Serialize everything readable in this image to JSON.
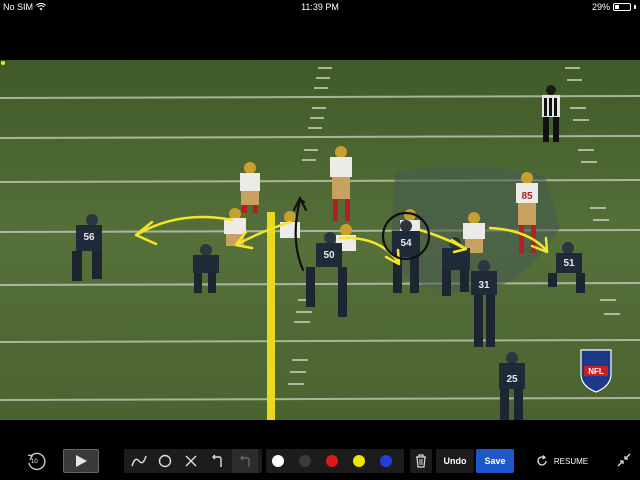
{
  "status_bar": {
    "carrier": "No SIM",
    "time": "11:39 PM",
    "battery": "29%",
    "battery_level": 0.29
  },
  "video": {
    "field_logo": "NFL",
    "jerseys": {
      "player_1": "56",
      "player_2": "50",
      "player_3": "54",
      "player_4": "31",
      "player_5": "51",
      "player_6": "25",
      "player_7": "85"
    }
  },
  "toolbar": {
    "rewind_label": "10",
    "play_icon": "play-icon",
    "drawing_tools": [
      "curve-tool-icon",
      "circle-tool-icon",
      "x-tool-icon",
      "arrow-tool-icon",
      "undo-arrow-icon"
    ],
    "colors": [
      "#ffffff",
      "#3a3a3a",
      "#e01818",
      "#f2e600",
      "#1f3fd8"
    ],
    "trash_icon": "trash-icon",
    "undo_label": "Undo",
    "save_label": "Save",
    "resume_label": "RESUME",
    "expand_icon": "collapse-arrows-icon"
  },
  "colors": {
    "annotation_yellow": "#f5e625",
    "field_green": "#5a7039",
    "save_blue": "#1e58c8"
  }
}
